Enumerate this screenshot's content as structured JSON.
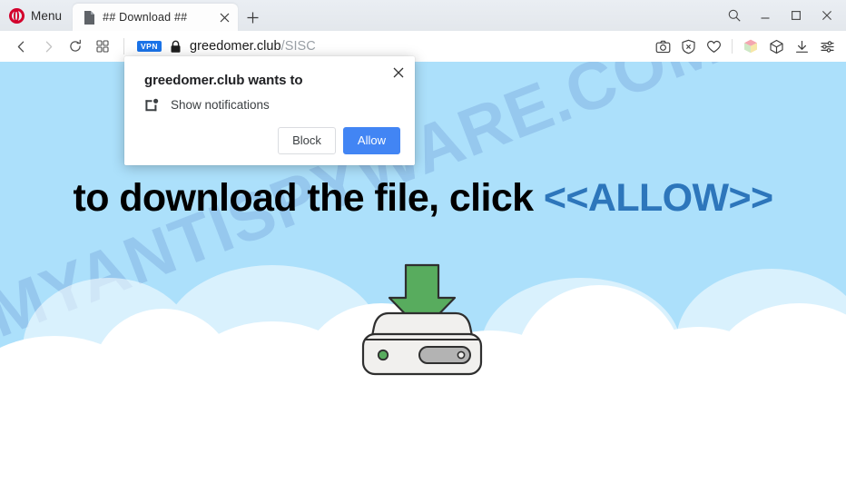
{
  "browser": {
    "menu_label": "Menu",
    "tab": {
      "title": "## Download ##",
      "favicon_icon": "page-document-icon",
      "close_icon": "close-icon"
    },
    "new_tab_icon": "plus-icon",
    "window_controls": {
      "search_icon": "search-icon",
      "minimize_icon": "minimize-icon",
      "maximize_icon": "maximize-icon",
      "close_icon": "close-icon"
    },
    "nav": {
      "back_icon": "chevron-left-icon",
      "forward_icon": "chevron-right-icon",
      "reload_icon": "reload-icon",
      "speeddial_icon": "grid-squares-icon"
    },
    "address": {
      "vpn_badge": "VPN",
      "lock_icon": "padlock-icon",
      "host": "greedomer.club",
      "path": "/SISC"
    },
    "right_tools": [
      {
        "name": "snapshot-camera-icon",
        "label": "Snapshot"
      },
      {
        "name": "ad-blocker-shield-icon",
        "label": "Ad blocker"
      },
      {
        "name": "heart-icon",
        "label": "Add to favourites"
      },
      {
        "name": "extensions-cube-color-icon",
        "label": "Extensions"
      },
      {
        "name": "workspaces-cube-icon",
        "label": "Workspaces"
      },
      {
        "name": "downloads-icon",
        "label": "Downloads"
      },
      {
        "name": "easy-setup-sliders-icon",
        "label": "Easy setup"
      }
    ],
    "accent_colors": {
      "opera_red": "#d3002c",
      "vpn_blue": "#1a73e8",
      "tabstrip_bg": "#e6eaef",
      "navbar_bg": "#ffffff"
    }
  },
  "dialog": {
    "title": "greedomer.club wants to",
    "permission_icon": "show-notifications-icon",
    "permission_label": "Show notifications",
    "close_icon": "close-icon",
    "block_label": "Block",
    "allow_label": "Allow",
    "allow_button_color": "#4285f4"
  },
  "page": {
    "headline_prefix": "to download the file, click ",
    "headline_allow": "<<ALLOW>>",
    "headline_allow_color": "#2d76bb",
    "watermark": "MYANTISPYWARE.COM",
    "sky_color": "#ace0fb",
    "cloud_color": "#ffffff",
    "illustration": {
      "name": "hard-drive-download-illustration",
      "arrow_color": "#58ac5e",
      "drive_body_color": "#f1f0ee",
      "drive_led_color": "#58ac5e",
      "drive_slot_color": "#b3b3b3"
    }
  }
}
